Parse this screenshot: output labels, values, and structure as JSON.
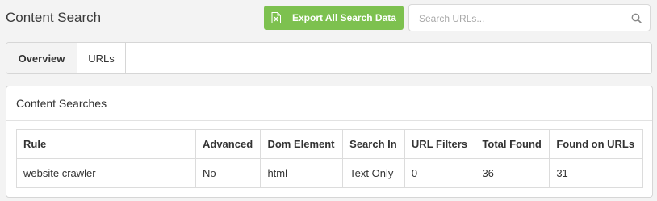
{
  "header": {
    "title": "Content Search",
    "export_label": "Export All Search Data",
    "search_placeholder": "Search URLs..."
  },
  "tabs": [
    {
      "label": "Overview",
      "active": true
    },
    {
      "label": "URLs",
      "active": false
    }
  ],
  "card": {
    "title": "Content Searches",
    "columns": [
      "Rule",
      "Advanced",
      "Dom Element",
      "Search In",
      "URL Filters",
      "Total Found",
      "Found on URLs"
    ],
    "rows": [
      [
        "website crawler",
        "No",
        "html",
        "Text Only",
        "0",
        "36",
        "31"
      ]
    ]
  },
  "colors": {
    "accent_green": "#7dc14f",
    "background": "#f3f3f3"
  },
  "icons": {
    "export": "spreadsheet-file-icon",
    "search": "magnifier-icon"
  }
}
